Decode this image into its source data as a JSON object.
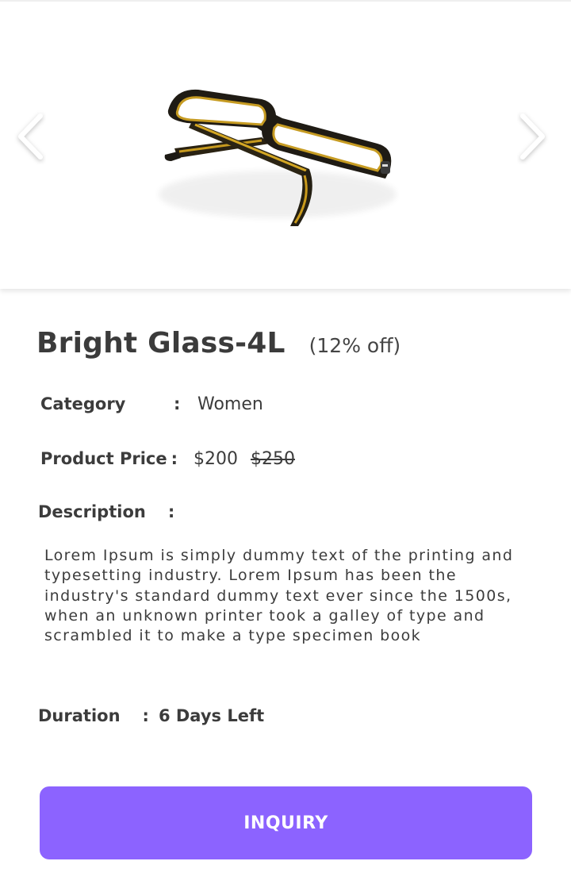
{
  "gallery": {
    "image_alt": "glasses-product-image",
    "prev_icon": "chevron-left-icon",
    "next_icon": "chevron-right-icon"
  },
  "product": {
    "title": "Bright Glass-4L",
    "discount": "(12% off)"
  },
  "details": {
    "category_label": "Category",
    "category_colon": ":",
    "category_value": "Women",
    "price_label": "Product Price",
    "price_colon": ":",
    "price_current": "$200",
    "price_original": "$250",
    "description_label": "Description",
    "description_colon": ":",
    "description_text": "Lorem Ipsum is simply dummy text of the printing and typesetting industry. Lorem Ipsum has been the industry's standard dummy text ever since the 1500s, when an unknown printer took a galley of type and scrambled it to make a type specimen book",
    "duration_label": "Duration",
    "duration_colon": ":",
    "duration_value": "6 Days Left"
  },
  "actions": {
    "inquiry_label": "INQUIRY"
  },
  "colors": {
    "accent": "#8c63ff",
    "text": "#3c3c3c",
    "background": "#ffffff"
  }
}
